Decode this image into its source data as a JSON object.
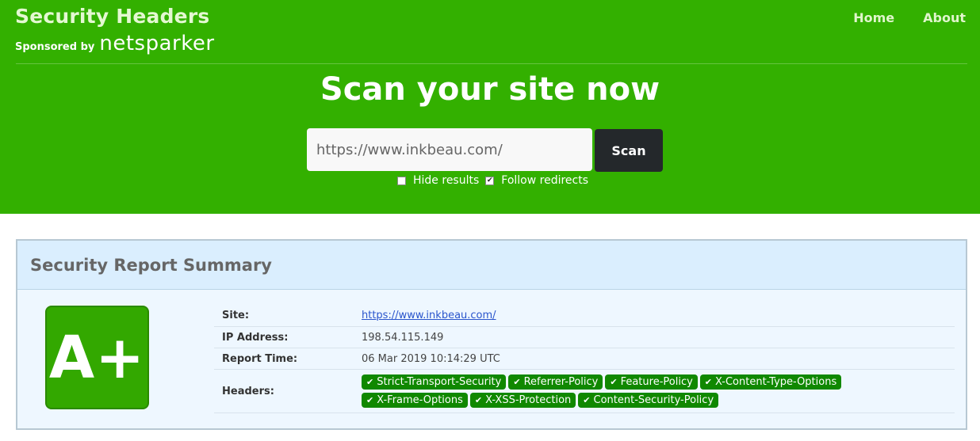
{
  "header": {
    "title": "Security Headers",
    "sponsor_text": "Sponsored by",
    "sponsor_logo": "netsparker",
    "nav": [
      {
        "label": "Home"
      },
      {
        "label": "About"
      }
    ]
  },
  "hero": {
    "title": "Scan your site now",
    "input_value": "https://www.inkbeau.com/",
    "scan_label": "Scan",
    "options": [
      {
        "label": "Hide results",
        "checked": false
      },
      {
        "label": "Follow redirects",
        "checked": true
      }
    ]
  },
  "report": {
    "title": "Security Report Summary",
    "grade": "A+",
    "rows": {
      "site_label": "Site:",
      "site_value": "https://www.inkbeau.com/",
      "ip_label": "IP Address:",
      "ip_value": "198.54.115.149",
      "time_label": "Report Time:",
      "time_value": "06 Mar 2019 10:14:29 UTC",
      "headers_label": "Headers:"
    },
    "headers": [
      "Strict-Transport-Security",
      "Referrer-Policy",
      "Feature-Policy",
      "X-Content-Type-Options",
      "X-Frame-Options",
      "X-XSS-Protection",
      "Content-Security-Policy"
    ]
  },
  "colors": {
    "hero_bg": "#33b000",
    "grade_bg": "#33a800",
    "badge_bg": "#108800",
    "scan_button_bg": "#24282b"
  },
  "icons": {
    "checkmark": "check-icon"
  }
}
